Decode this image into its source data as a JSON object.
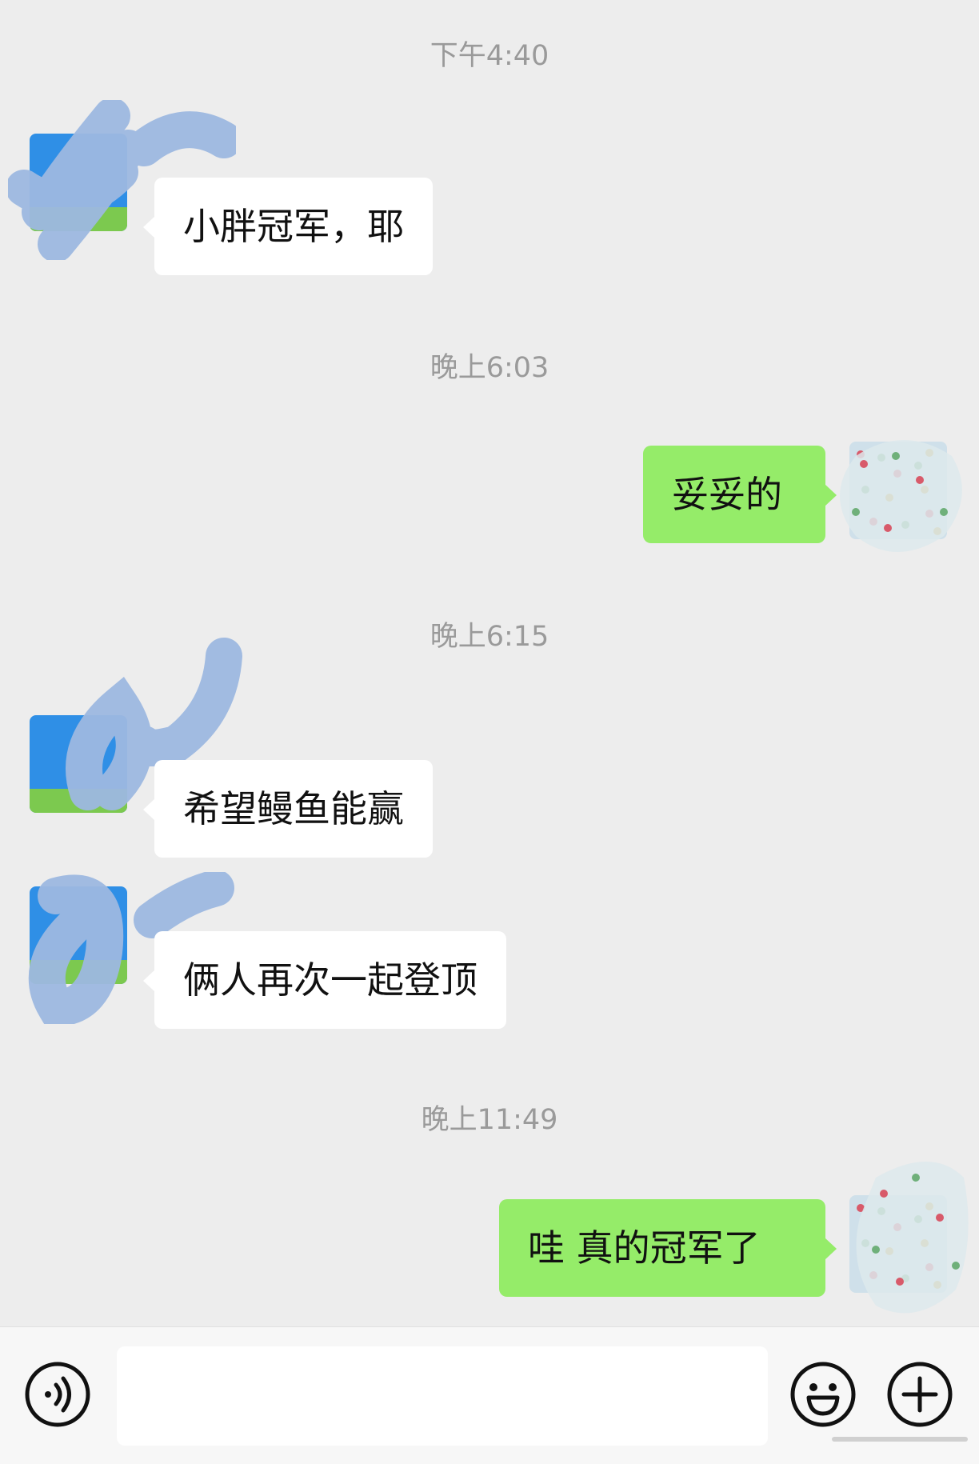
{
  "messages": [
    {
      "type": "timestamp",
      "text": "下午4:40"
    },
    {
      "type": "incoming",
      "text": "小胖冠军，耶"
    },
    {
      "type": "timestamp",
      "text": "晚上6:03"
    },
    {
      "type": "outgoing",
      "text": "妥妥的"
    },
    {
      "type": "timestamp",
      "text": "晚上6:15"
    },
    {
      "type": "incoming",
      "text": "希望鳗鱼能赢"
    },
    {
      "type": "incoming",
      "text": "俩人再次一起登顶"
    },
    {
      "type": "timestamp",
      "text": "晚上11:49"
    },
    {
      "type": "outgoing",
      "text": "哇 真的冠军了"
    }
  ],
  "input_bar": {
    "voice_icon": "voice-icon",
    "emoji_icon": "emoji-icon",
    "plus_icon": "plus-icon",
    "text_value": ""
  },
  "colors": {
    "background": "#ededed",
    "outgoing_bubble": "#95ec69",
    "incoming_bubble": "#ffffff",
    "timestamp_text": "#9a9a9a",
    "redaction_scribble": "#9db8e0"
  }
}
